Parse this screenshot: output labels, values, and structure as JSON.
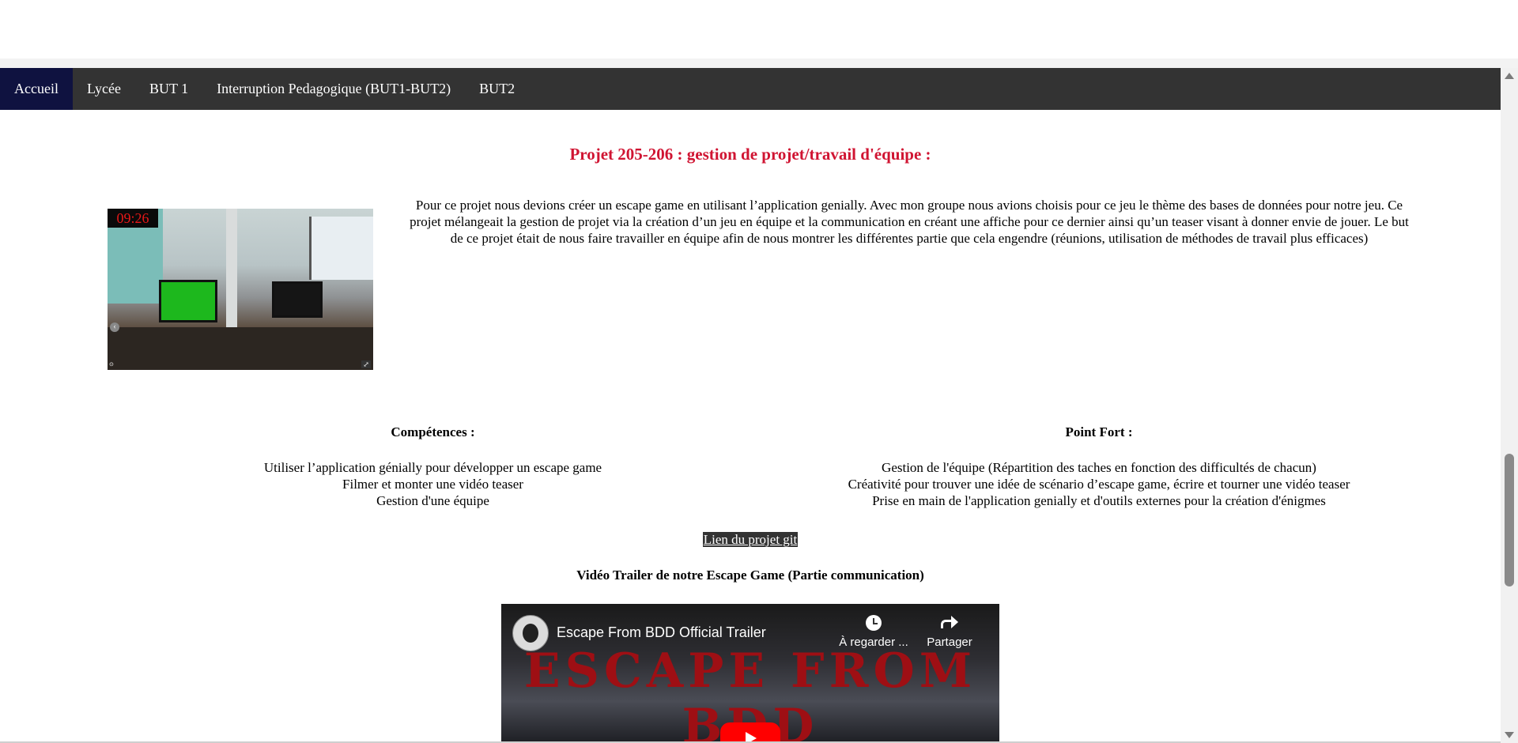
{
  "nav": {
    "items": [
      "Accueil",
      "Lycée",
      "BUT 1",
      "Interruption Pedagogique (BUT1-BUT2)",
      "BUT2"
    ],
    "active": "Accueil"
  },
  "project": {
    "title": "Projet 205-206 : gestion de projet/travail d'équipe :",
    "timer": "09:26",
    "description": "Pour ce projet nous devions créer un escape game en utilisant l’application genially. Avec mon groupe nous avions choisis pour ce jeu le thème des bases de données pour notre jeu. Ce projet mélangeait la gestion de projet via la création d’un jeu en équipe et la communication en créant une affiche pour ce dernier ainsi qu’un teaser visant à donner envie de jouer. Le but de ce projet était de nous faire travailler en équipe afin de nous montrer les différentes partie que cela engendre (réunions, utilisation de méthodes de travail plus efficaces)"
  },
  "competences": {
    "heading": "Compétences :",
    "items": [
      "Utiliser l’application génially pour développer un escape game",
      "Filmer et monter une vidéo teaser",
      "Gestion d'une équipe"
    ]
  },
  "point_fort": {
    "heading": "Point Fort :",
    "items": [
      "Gestion de l'équipe (Répartition des taches en fonction des difficultés de chacun)",
      "Créativité pour trouver une idée de scénario d’escape game, écrire et tourner une vidéo teaser",
      "Prise en main de l'application genially et d'outils externes pour la création d'énigmes"
    ]
  },
  "git_link": "Lien du projet git",
  "video": {
    "section_title": "Vidéo Trailer de notre Escape Game (Partie communication)",
    "title": "Escape From BDD Official Trailer",
    "big_text": "ESCAPE FROM BDD",
    "watch_later": "À regarder ...",
    "share": "Partager"
  }
}
